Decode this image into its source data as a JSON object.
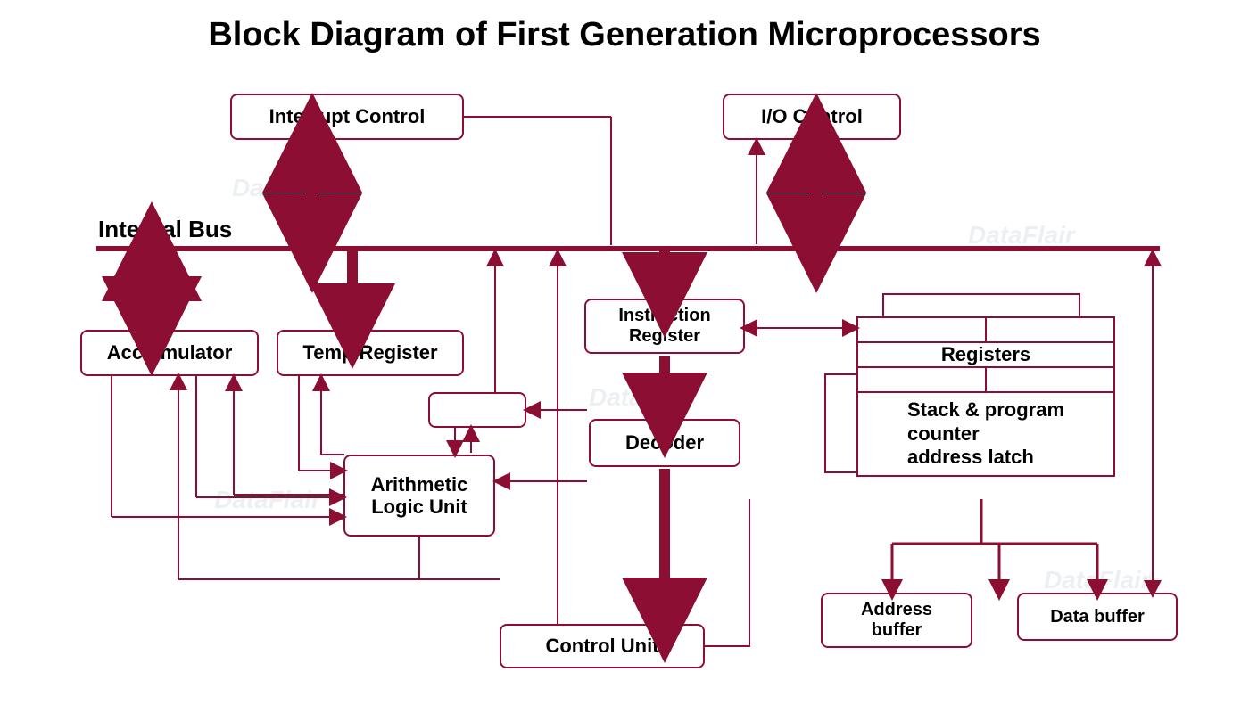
{
  "title": "Block Diagram of First Generation Microprocessors",
  "bus_label": "Internal Bus",
  "blocks": {
    "interrupt": "Interrupt Control",
    "io": "I/O Control",
    "accumulator": "Acculmulator",
    "tempreg": "Temp.Register",
    "instreg": "Instruction\nRegister",
    "decoder": "Decoder",
    "alu": "Arithmetic\nLogic Unit",
    "control": "Control Unit",
    "addrbuf": "Address\nbuffer",
    "databuf": "Data buffer",
    "registers": "Registers",
    "stack": "Stack & program\ncounter\naddress latch"
  },
  "watermark": "DataFlair",
  "colors": {
    "stroke": "#8c0f33",
    "thin": 2,
    "thick": 6
  }
}
